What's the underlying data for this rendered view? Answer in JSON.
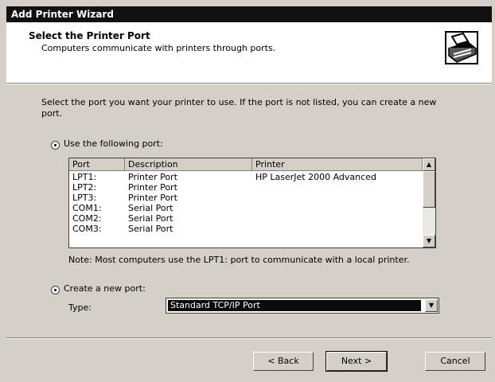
{
  "window": {
    "title": "Add Printer Wizard"
  },
  "header": {
    "title": "Select the Printer Port",
    "subtitle": "Computers communicate with printers through ports."
  },
  "intro": "Select the port you want your printer to use. If the port is not listed, you can create a new port.",
  "existing_port": {
    "label": "Use the following port:",
    "selected": true,
    "columns": [
      "Port",
      "Description",
      "Printer"
    ],
    "rows": [
      {
        "port": "LPT1:",
        "description": "Printer Port",
        "printer": "HP LaserJet 2000 Advanced"
      },
      {
        "port": "LPT2:",
        "description": "Printer Port",
        "printer": ""
      },
      {
        "port": "LPT3:",
        "description": "Printer Port",
        "printer": ""
      },
      {
        "port": "COM1:",
        "description": "Serial Port",
        "printer": ""
      },
      {
        "port": "COM2:",
        "description": "Serial Port",
        "printer": ""
      },
      {
        "port": "COM3:",
        "description": "Serial Port",
        "printer": ""
      }
    ]
  },
  "note": "Note: Most computers use the LPT1: port to communicate with a local printer.",
  "new_port": {
    "label": "Create a new port:",
    "selected": true,
    "type_label": "Type:",
    "type_value": "Standard TCP/IP Port"
  },
  "buttons": {
    "back": "< Back",
    "next": "Next >",
    "cancel": "Cancel"
  },
  "icons": {
    "wizard": "printer-wizard-icon",
    "scroll_up": "scroll-up-arrow-icon",
    "scroll_down": "scroll-down-arrow-icon",
    "dropdown": "dropdown-arrow-icon"
  }
}
